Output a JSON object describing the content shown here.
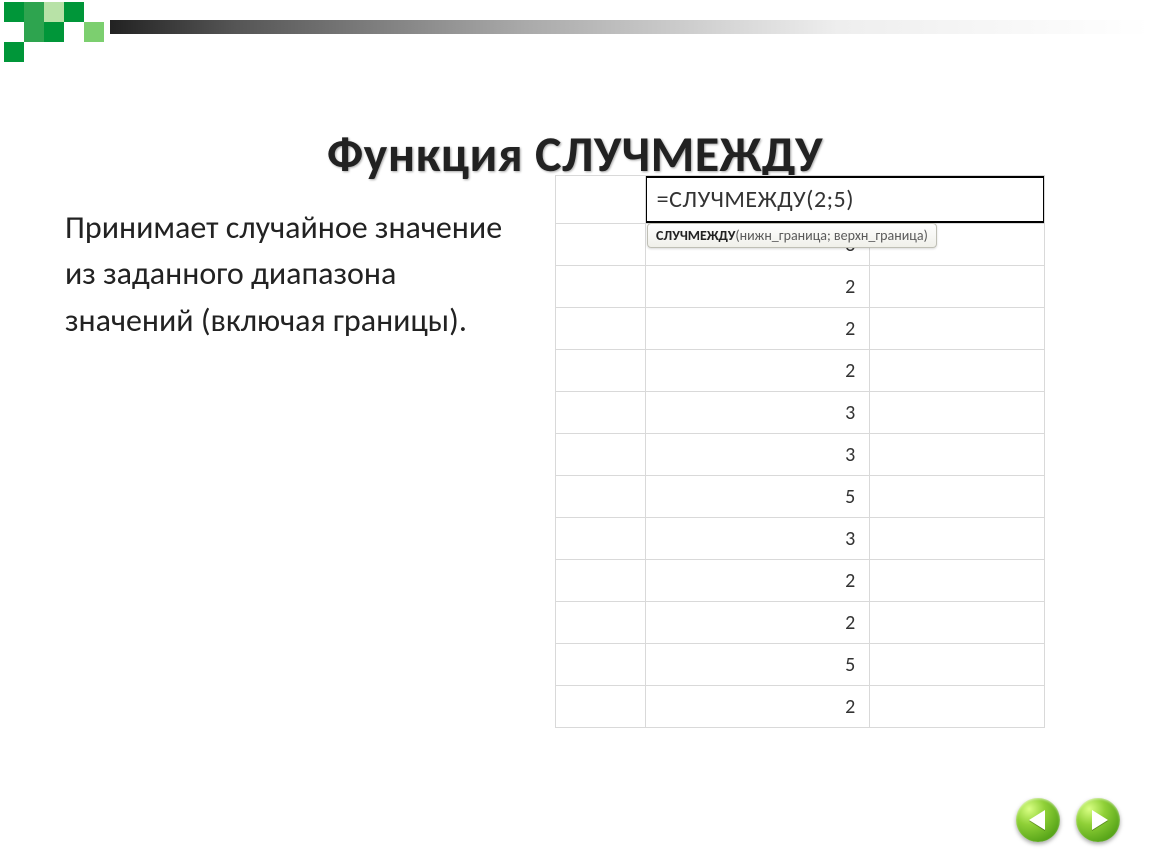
{
  "title": "Функция СЛУЧМЕЖДУ",
  "description": "Принимает случайное значение из заданного диапазона значений (включая границы).",
  "sheet": {
    "formula": "=СЛУЧМЕЖДУ(2;5)",
    "tooltip_fn": "СЛУЧМЕЖДУ",
    "tooltip_args": "(нижн_граница; верхн_граница)",
    "values": [
      "3",
      "2",
      "2",
      "2",
      "3",
      "3",
      "5",
      "3",
      "2",
      "2",
      "5",
      "2"
    ]
  }
}
